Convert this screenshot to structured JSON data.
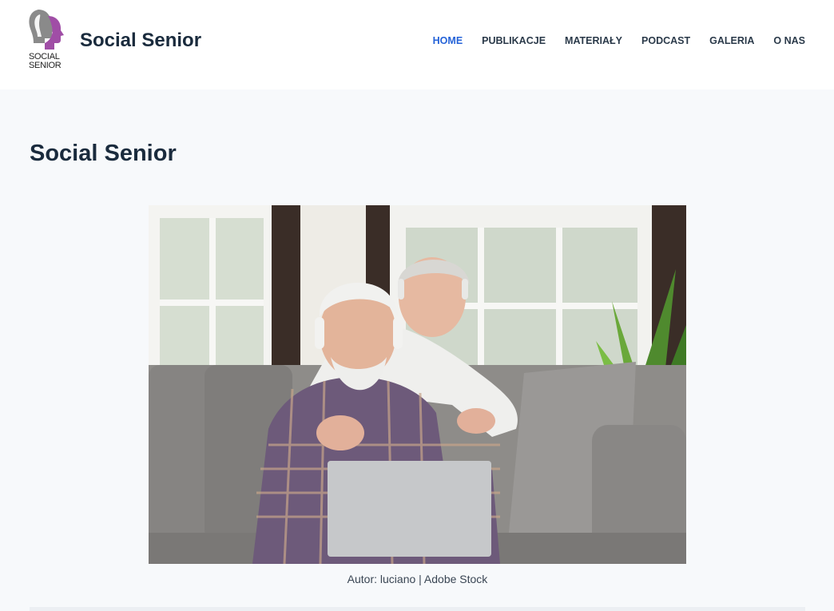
{
  "header": {
    "logo_text_line1": "SOCIAL",
    "logo_text_line2": "SENIOR",
    "site_title": "Social Senior"
  },
  "nav": {
    "items": [
      {
        "label": "HOME",
        "active": true
      },
      {
        "label": "PUBLIKACJE",
        "active": false
      },
      {
        "label": "MATERIAŁY",
        "active": false
      },
      {
        "label": "PODCAST",
        "active": false
      },
      {
        "label": "GALERIA",
        "active": false
      },
      {
        "label": "O NAS",
        "active": false
      }
    ]
  },
  "main": {
    "page_title": "Social Senior",
    "image_caption": "Autor: luciano | Adobe Stock"
  },
  "colors": {
    "accent": "#2563d8",
    "text": "#1a2b3d",
    "logo_purple": "#a04ea6",
    "logo_gray": "#8a8a8a"
  }
}
